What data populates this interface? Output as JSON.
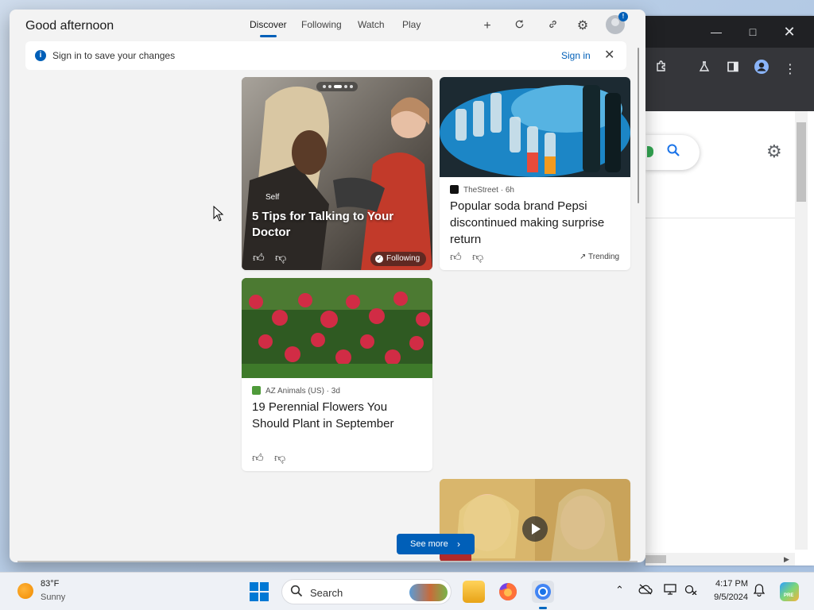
{
  "widgets": {
    "greeting": "Good afternoon",
    "tabs": [
      {
        "label": "Discover",
        "active": true
      },
      {
        "label": "Following",
        "active": false
      },
      {
        "label": "Watch",
        "active": false
      },
      {
        "label": "Play",
        "active": false
      }
    ],
    "header_icons": [
      "add-icon",
      "refresh-icon",
      "link-icon",
      "settings-icon",
      "profile-icon"
    ],
    "profile_badge": "!",
    "banner": {
      "message": "Sign in to save your changes",
      "signin_label": "Sign in"
    },
    "cards": [
      {
        "category": "Self",
        "title": "5 Tips for Talking to Your Doctor",
        "following_label": "Following"
      },
      {
        "source": "TheStreet",
        "age": "6h",
        "title": "Popular soda brand Pepsi discontinued making surprise return",
        "trending_label": "Trending"
      },
      {
        "source": "AZ Animals (US)",
        "age": "3d",
        "title": "19 Perennial Flowers You Should Plant in September"
      }
    ],
    "see_more_label": "See more"
  },
  "taskbar": {
    "weather": {
      "temp": "83°F",
      "desc": "Sunny"
    },
    "search_label": "Search",
    "time": "4:17 PM",
    "date": "9/5/2024",
    "copilot_badge": "PRE"
  },
  "colors": {
    "accent": "#005fb8",
    "panel_bg": "#f3f3f3",
    "chrome_dark": "#202124",
    "chrome_toolbar": "#35363a"
  }
}
